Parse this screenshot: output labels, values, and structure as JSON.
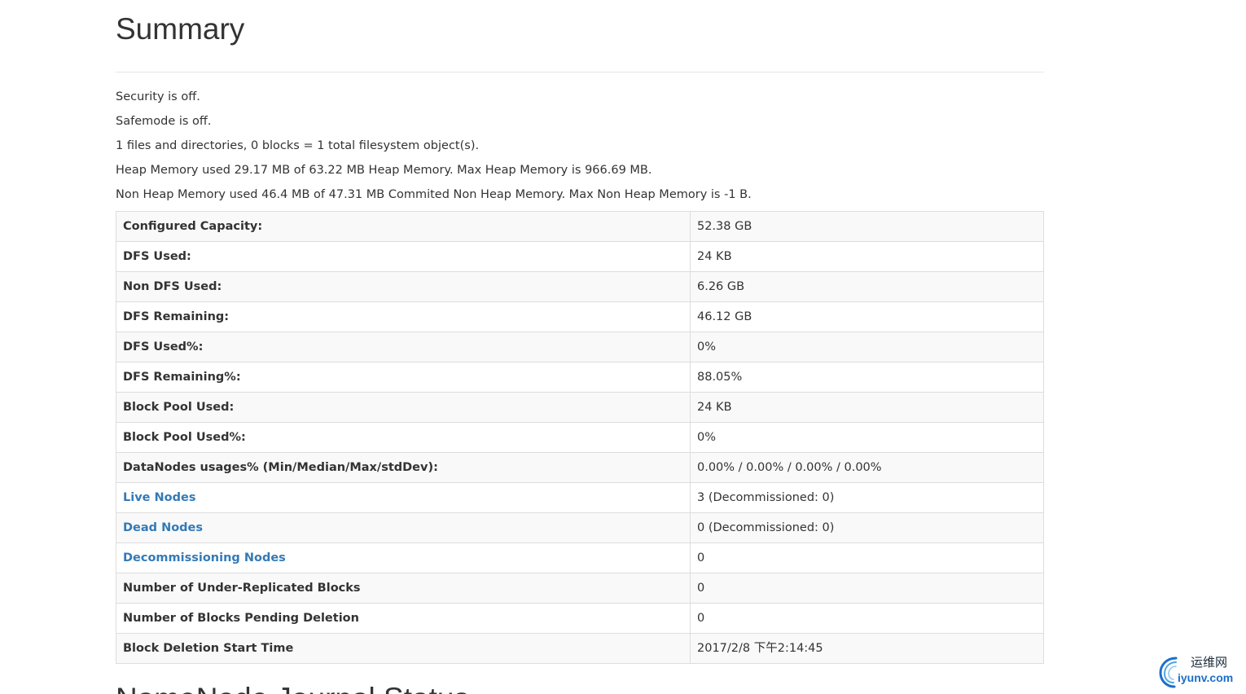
{
  "summary": {
    "title": "Summary",
    "lines": [
      "Security is off.",
      "Safemode is off.",
      "1 files and directories, 0 blocks = 1 total filesystem object(s).",
      "Heap Memory used 29.17 MB of 63.22 MB Heap Memory. Max Heap Memory is 966.69 MB.",
      "Non Heap Memory used 46.4 MB of 47.31 MB Commited Non Heap Memory. Max Non Heap Memory is -1 B."
    ]
  },
  "table": {
    "rows": [
      {
        "label": "Configured Capacity:",
        "value": "52.38 GB"
      },
      {
        "label": "DFS Used:",
        "value": "24 KB"
      },
      {
        "label": "Non DFS Used:",
        "value": "6.26 GB"
      },
      {
        "label": "DFS Remaining:",
        "value": "46.12 GB"
      },
      {
        "label": "DFS Used%:",
        "value": "0%"
      },
      {
        "label": "DFS Remaining%:",
        "value": "88.05%"
      },
      {
        "label": "Block Pool Used:",
        "value": "24 KB"
      },
      {
        "label": "Block Pool Used%:",
        "value": "0%"
      },
      {
        "label": "DataNodes usages% (Min/Median/Max/stdDev):",
        "value": "0.00% / 0.00% / 0.00% / 0.00%"
      },
      {
        "label": "Live Nodes",
        "value": "3 (Decommissioned: 0)"
      },
      {
        "label": "Dead Nodes",
        "value": "0 (Decommissioned: 0)"
      },
      {
        "label": "Decommissioning Nodes",
        "value": "0"
      },
      {
        "label": "Number of Under-Replicated Blocks",
        "value": "0"
      },
      {
        "label": "Number of Blocks Pending Deletion",
        "value": "0"
      },
      {
        "label": "Block Deletion Start Time",
        "value": "2017/2/8 下午2:14:45"
      }
    ]
  },
  "next_section": {
    "title": "NameNode Journal Status"
  },
  "watermark": {
    "top_text": "运维网",
    "bottom_text": "iyunv.com",
    "colors": {
      "blue": "#1b6fc9",
      "dark": "#1a2a3a"
    }
  },
  "colors": {
    "link": "#337ab7",
    "text": "#333333",
    "border": "#dddddd",
    "stripe": "#f9f9f9"
  }
}
